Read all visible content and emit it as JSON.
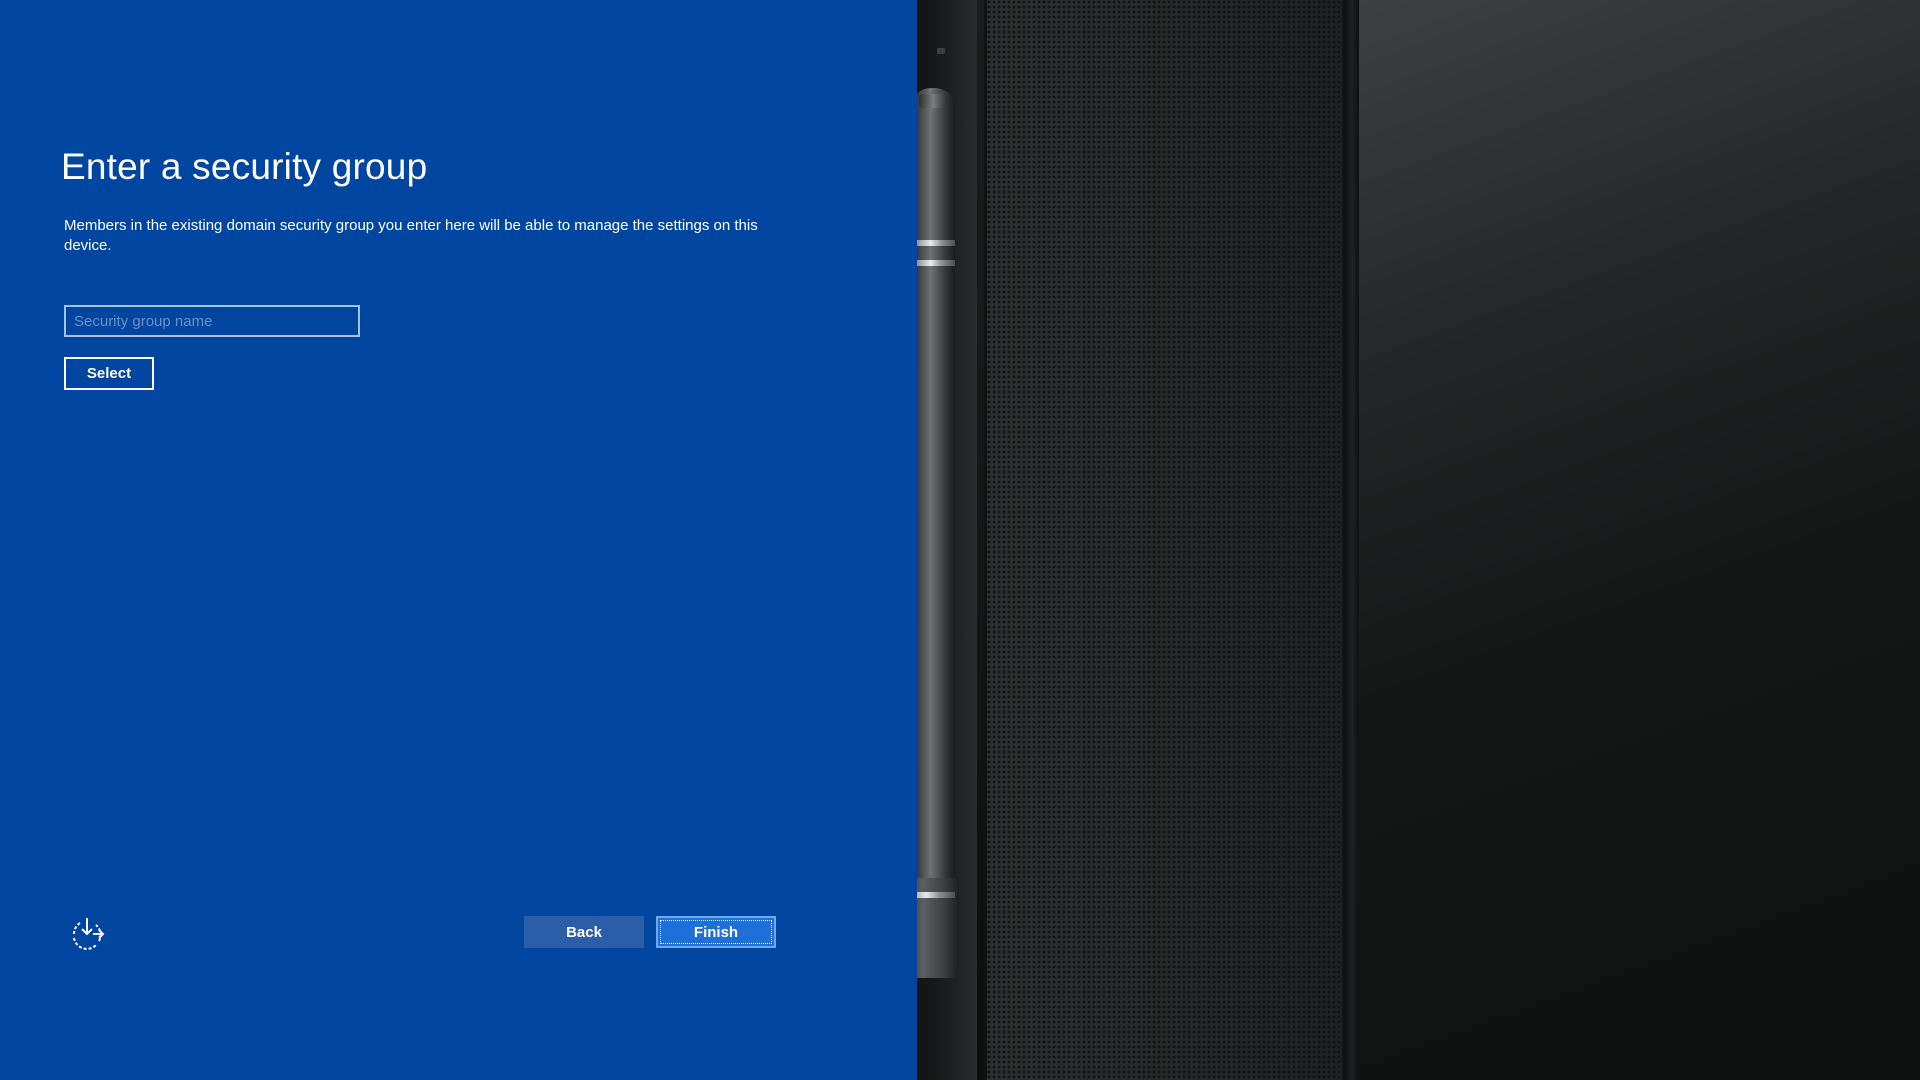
{
  "page": {
    "title": "Enter a security group",
    "description": "Members in the existing domain security group you enter here will be able to manage the settings on this device."
  },
  "form": {
    "group_input_placeholder": "Security group name",
    "group_input_value": "",
    "select_label": "Select"
  },
  "footer": {
    "ease_of_access_icon": "ease-of-access-icon",
    "back_label": "Back",
    "finish_label": "Finish"
  },
  "theme": {
    "panel_background": "#0046a0",
    "primary_button": "#1e6fd9",
    "secondary_button": "#2c5ea8",
    "text": "#ffffff"
  }
}
